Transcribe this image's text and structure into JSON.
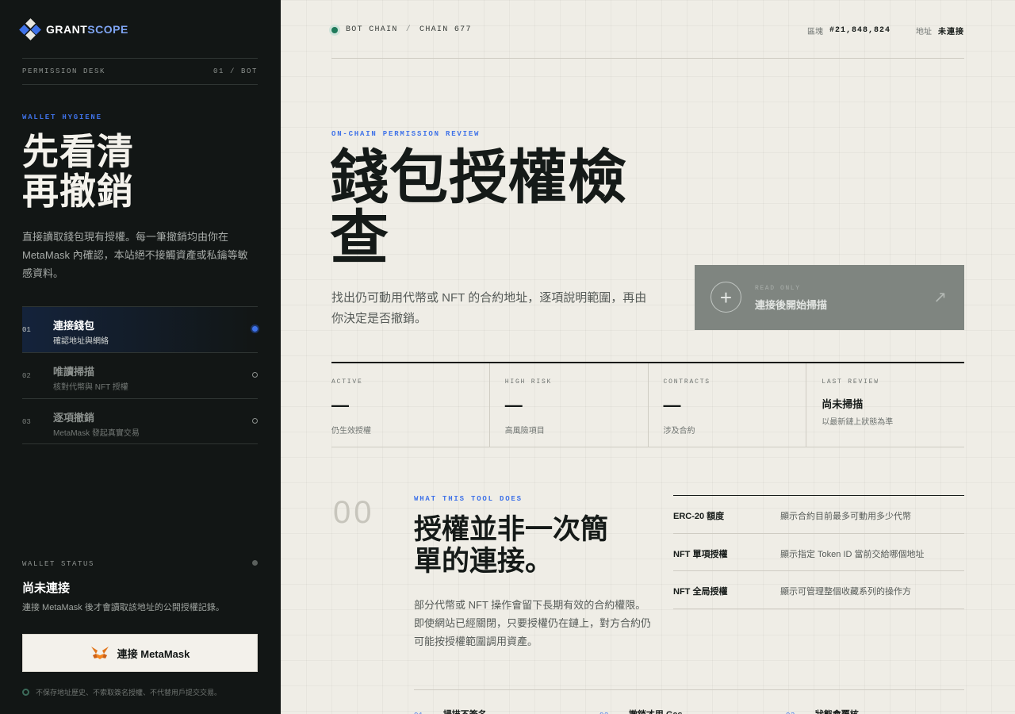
{
  "brand": {
    "name_main": "GRANT",
    "name_accent": "SCOPE",
    "colors": {
      "accent": "#3f72e8",
      "logo_blue": "#7ea4f2",
      "sidebar_bg": "#121615",
      "status_green": "#1f7a5a"
    }
  },
  "sidebar": {
    "meta_left": "PERMISSION DESK",
    "meta_right": "01 / BOT",
    "eyebrow": "WALLET HYGIENE",
    "title_line1": "先看清",
    "title_line2": "再撤銷",
    "description": "直接讀取錢包現有授權。每一筆撤銷均由你在 MetaMask 內確認，本站絕不接觸資產或私鑰等敏感資料。",
    "steps": [
      {
        "num": "01",
        "title": "連接錢包",
        "sub": "確認地址與網絡",
        "active": true
      },
      {
        "num": "02",
        "title": "唯讀掃描",
        "sub": "核對代幣與 NFT 授權",
        "active": false
      },
      {
        "num": "03",
        "title": "逐項撤銷",
        "sub": "MetaMask 發起真實交易",
        "active": false
      }
    ],
    "wallet_status_label": "WALLET STATUS",
    "wallet_status_title": "尚未連接",
    "wallet_status_sub": "連接 MetaMask 後才會讀取該地址的公開授權記錄。",
    "connect_button": "連接 MetaMask",
    "connect_icon": "metamask-fox-icon",
    "privacy_note": "不保存地址歷史、不索取簽名授權、不代替用戶提交交易。"
  },
  "topbar": {
    "chain_label": "BOT CHAIN",
    "separator": "/",
    "chain_id": "CHAIN 677",
    "block_label": "區塊",
    "block_value": "#21,848,824",
    "address_label": "地址",
    "address_value": "未連接"
  },
  "hero": {
    "eyebrow": "ON-CHAIN PERMISSION REVIEW",
    "title_line1": "錢包授權檢",
    "title_line2": "查",
    "description": "找出仍可動用代幣或 NFT 的合約地址，逐項說明範圍，再由你決定是否撤銷。",
    "scan_card": {
      "tag": "READ ONLY",
      "title": "連接後開始掃描",
      "plus": "+",
      "arrow": "↗"
    }
  },
  "stats": [
    {
      "label": "ACTIVE",
      "value": "—",
      "sub": "仍生效授權"
    },
    {
      "label": "HIGH RISK",
      "value": "—",
      "sub": "高風險項目"
    },
    {
      "label": "CONTRACTS",
      "value": "—",
      "sub": "涉及合約"
    },
    {
      "label": "LAST REVIEW",
      "value": "尚未掃描",
      "sub": "以最新鏈上狀態為準"
    }
  ],
  "section": {
    "number": "00",
    "eyebrow": "WHAT THIS TOOL DOES",
    "title_line1": "授權並非一次簡",
    "title_line2": "單的連接。",
    "description": "部分代幣或 NFT 操作會留下長期有效的合約權限。即使網站已經關閉，只要授權仍在鏈上，對方合約仍可能按授權範圍調用資產。",
    "permissions": [
      {
        "name": "ERC-20 額度",
        "desc": "顯示合約目前最多可動用多少代幣"
      },
      {
        "name": "NFT 單項授權",
        "desc": "顯示指定 Token ID 當前交給哪個地址"
      },
      {
        "name": "NFT 全局授權",
        "desc": "顯示可管理整個收藏系列的操作方"
      }
    ],
    "features": [
      {
        "num": "01",
        "title": "掃描不簽名"
      },
      {
        "num": "02",
        "title": "撤銷才用 Gas"
      },
      {
        "num": "03",
        "title": "狀態會覆核"
      }
    ]
  }
}
